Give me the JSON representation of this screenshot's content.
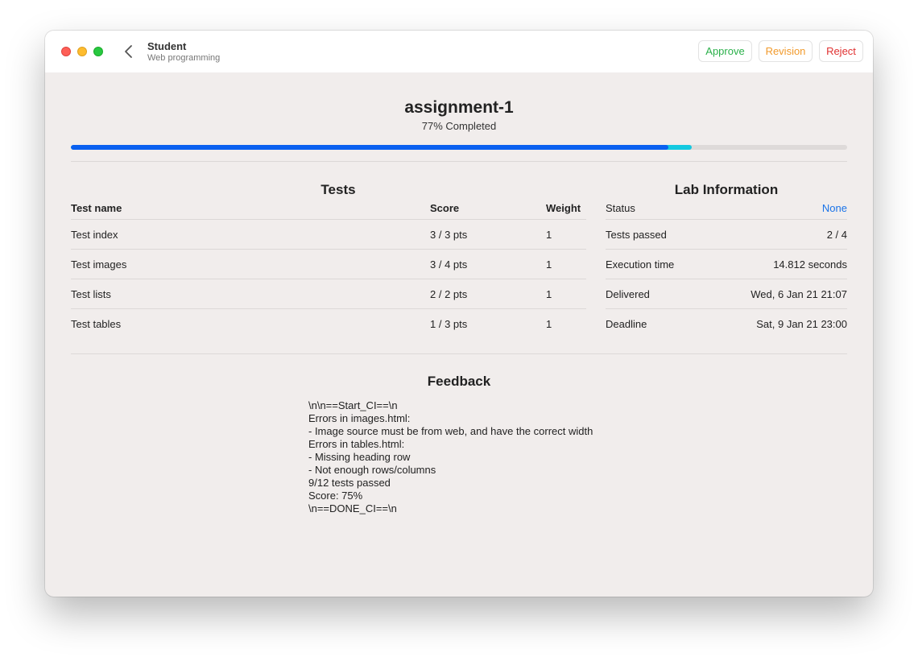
{
  "titlebar": {
    "title": "Student",
    "subtitle": "Web programming",
    "approve_label": "Approve",
    "revision_label": "Revision",
    "reject_label": "Reject"
  },
  "assignment": {
    "title": "assignment-1",
    "completion_text": "77% Completed",
    "progress_primary": 0.77,
    "progress_secondary": 0.8
  },
  "tests": {
    "title": "Tests",
    "headers": {
      "name": "Test name",
      "score": "Score",
      "weight": "Weight"
    },
    "rows": [
      {
        "name": "Test index",
        "score": "3 / 3 pts",
        "weight": "1"
      },
      {
        "name": "Test images",
        "score": "3 / 4 pts",
        "weight": "1"
      },
      {
        "name": "Test lists",
        "score": "2 / 2 pts",
        "weight": "1"
      },
      {
        "name": "Test tables",
        "score": "1 / 3 pts",
        "weight": "1"
      }
    ]
  },
  "lab": {
    "title": "Lab Information",
    "rows": [
      {
        "label": "Status",
        "value": "None"
      },
      {
        "label": "Tests passed",
        "value": "2 / 4"
      },
      {
        "label": "Execution time",
        "value": "14.812 seconds"
      },
      {
        "label": "Delivered",
        "value": "Wed, 6 Jan 21 21:07"
      },
      {
        "label": "Deadline",
        "value": "Sat, 9 Jan 21 23:00"
      }
    ]
  },
  "feedback": {
    "title": "Feedback",
    "text": "\\n\\n==Start_CI==\\n\nErrors in images.html:\n- Image source must be from web, and have the correct width\nErrors in tables.html:\n- Missing heading row\n- Not enough rows/columns\n9/12 tests passed\nScore: 75%\n\\n==DONE_CI==\\n"
  },
  "colors": {
    "approve": "#2ab04a",
    "revision": "#f19a2c",
    "reject": "#e03131",
    "progress": "#0a60f0",
    "progress_secondary": "#14c9e0",
    "status_link": "#1a73e8"
  }
}
